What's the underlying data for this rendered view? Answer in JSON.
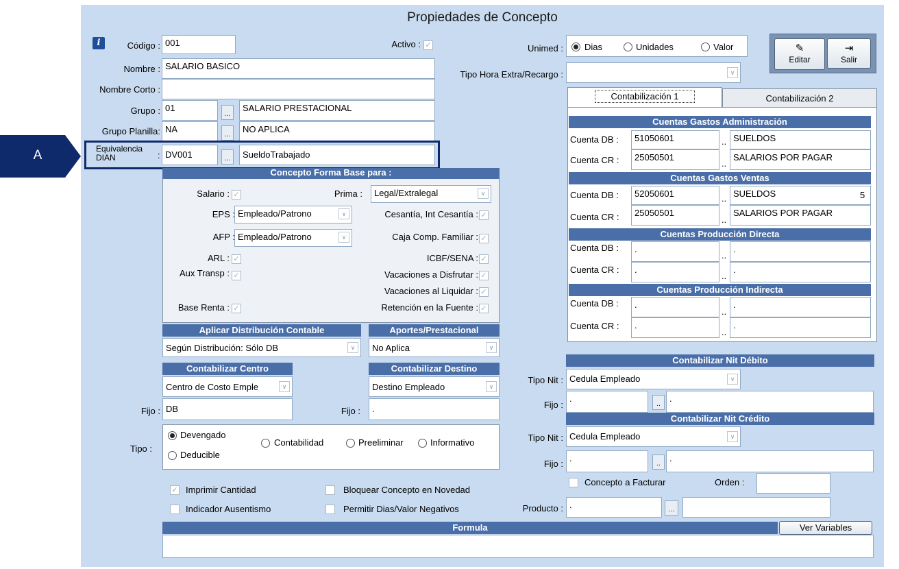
{
  "title": "Propiedades de Concepto",
  "callout": {
    "label": "A"
  },
  "left": {
    "codigo": {
      "label": "Código :",
      "value": "001"
    },
    "activo": {
      "label": "Activo :"
    },
    "nombre": {
      "label": "Nombre :",
      "value": "SALARIO BASICO"
    },
    "nombre_corto": {
      "label": "Nombre Corto :",
      "value": ""
    },
    "grupo": {
      "label": "Grupo :",
      "code": "01",
      "desc": "SALARIO PRESTACIONAL"
    },
    "grupo_planilla": {
      "label": "Grupo Planilla:",
      "code": "NA",
      "desc": "NO APLICA"
    },
    "equivalencia": {
      "label1": "Equivalencia",
      "label2": "DIAN",
      "code": "DV001",
      "desc": "SueldoTrabajado"
    },
    "dots": "..."
  },
  "forma_base": {
    "header": "Concepto Forma Base para :",
    "salario": "Salario :",
    "prima": {
      "label": "Prima :",
      "value": "Legal/Extralegal"
    },
    "eps": {
      "label": "EPS :",
      "value": "Empleado/Patrono"
    },
    "cesantia": "Cesantía, Int Cesantía :",
    "afp": {
      "label": "AFP :",
      "value": "Empleado/Patrono"
    },
    "caja": "Caja Comp. Familiar :",
    "arl": "ARL :",
    "icbf": "ICBF/SENA :",
    "aux": "Aux Transp :",
    "vac_disfrutar": "Vacaciones a Disfrutar :",
    "vac_liquidar": "Vacaciones al Liquidar :",
    "base_renta": "Base Renta :",
    "retencion": "Retención en la Fuente :"
  },
  "distribucion": {
    "header": "Aplicar Distribución Contable",
    "value": "Según Distribución: Sólo DB"
  },
  "aportes": {
    "header": "Aportes/Prestacional",
    "value": "No Aplica"
  },
  "centro": {
    "header": "Contabilizar Centro",
    "value": "Centro de Costo Emple",
    "fijo_label": "Fijo :",
    "fijo_value": "DB"
  },
  "destino": {
    "header": "Contabilizar Destino",
    "value": "Destino Empleado",
    "fijo_label": "Fijo :",
    "fijo_value": "."
  },
  "tipo": {
    "label": "Tipo :",
    "devengado": "Devengado",
    "contabilidad": "Contabilidad",
    "preeliminar": "Preeliminar",
    "informativo": "Informativo",
    "deducible": "Deducible"
  },
  "checks": {
    "imprimir": "Imprimir Cantidad",
    "bloquear": "Bloquear Concepto en Novedad",
    "ausentismo": "Indicador Ausentismo",
    "negativos": "Permitir Dias/Valor Negativos"
  },
  "formula": {
    "header": "Formula",
    "ver_variables": "Ver Variables"
  },
  "unimed": {
    "label": "Unimed :",
    "dias": "Dias",
    "unidades": "Unidades",
    "valor": "Valor"
  },
  "tipo_hora": {
    "label": "Tipo Hora Extra/Recargo :",
    "value": ""
  },
  "buttons": {
    "editar": "Editar",
    "salir": "Salir"
  },
  "tabs": {
    "tab1": "Contabilización 1",
    "tab2": "Contabilización 2"
  },
  "cuentas": {
    "admin": {
      "header": "Cuentas Gastos Administración",
      "db_label": "Cuenta DB :",
      "db_code": "51050601",
      "db_desc": "SUELDOS",
      "cr_label": "Cuenta CR :",
      "cr_code": "25050501",
      "cr_desc": "SALARIOS POR PAGAR"
    },
    "ventas": {
      "header": "Cuentas Gastos Ventas",
      "db_label": "Cuenta DB :",
      "db_code": "52050601",
      "db_desc": "SUELDOS",
      "db_extra": "5",
      "cr_label": "Cuenta CR :",
      "cr_code": "25050501",
      "cr_desc": "SALARIOS POR PAGAR"
    },
    "prod_directa": {
      "header": "Cuentas Producción Directa",
      "db_label": "Cuenta DB :",
      "db_code": ".",
      "db_desc": ".",
      "cr_label": "Cuenta CR :",
      "cr_code": ".",
      "cr_desc": "."
    },
    "prod_indirecta": {
      "header": "Cuentas Producción Indirecta",
      "db_label": "Cuenta DB :",
      "db_code": ".",
      "db_desc": ".",
      "cr_label": "Cuenta CR :",
      "cr_code": ".",
      "cr_desc": "."
    },
    "sep": ".."
  },
  "nit_debito": {
    "header": "Contabilizar Nit Débito",
    "tipo_label": "Tipo Nit :",
    "tipo_value": "Cedula Empleado",
    "fijo_label": "Fijo :",
    "fijo_code": ".",
    "fijo_desc": "."
  },
  "nit_credito": {
    "header": "Contabilizar Nit Crédito",
    "tipo_label": "Tipo Nit :",
    "tipo_value": "Cedula Empleado",
    "fijo_label": "Fijo :",
    "fijo_code": ".",
    "fijo_desc": "."
  },
  "facturar": {
    "label": "Concepto a Facturar",
    "orden_label": "Orden :",
    "orden_value": "",
    "producto_label": "Producto :",
    "producto_code": ".",
    "producto_desc": ""
  },
  "colors": {
    "window": "#c9dbf0",
    "header": "#4a6ea8",
    "callout": "#0f2a6b",
    "highlight": "#0f2a6b"
  }
}
